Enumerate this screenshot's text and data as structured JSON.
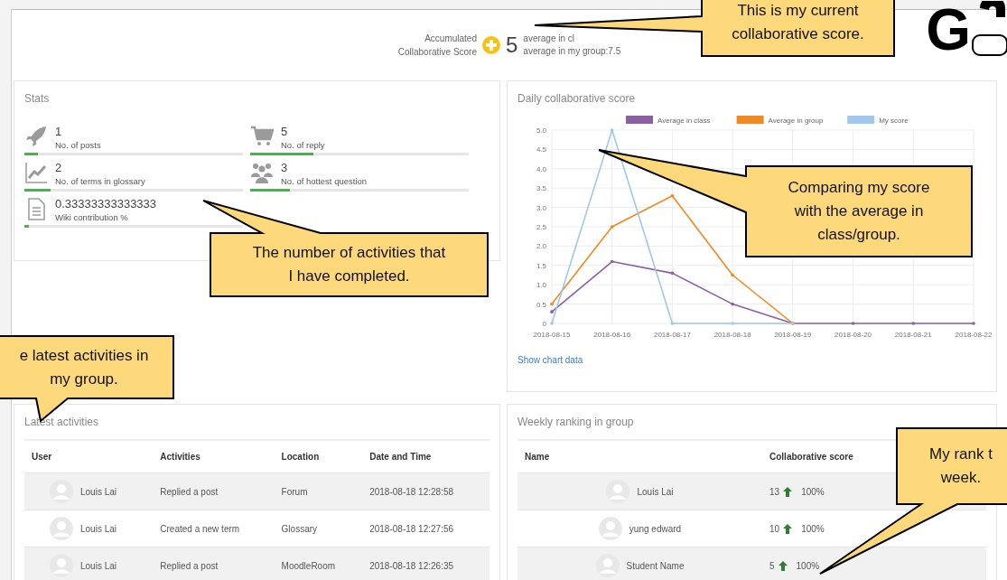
{
  "header": {
    "score_label": "Accumulated Collaborative Score",
    "score": "5",
    "average_class": "average in cl",
    "average_group": "average in my group:7.5"
  },
  "logo": {
    "text": "G"
  },
  "stats": {
    "title": "Stats",
    "items": [
      {
        "value": "1",
        "label": "No. of posts",
        "level": 0.06
      },
      {
        "value": "5",
        "label": "No. of reply",
        "level": 0.29
      },
      {
        "value": "2",
        "label": "No. of terms in glossary",
        "level": 0.12
      },
      {
        "value": "3",
        "label": "No. of hottest question",
        "level": 0.18
      },
      {
        "value": "0.33333333333333",
        "label": "Wiki contribution %",
        "level": 0.02
      }
    ]
  },
  "daily": {
    "title": "Daily collaborative score",
    "link": "Show chart data",
    "chart_data": {
      "type": "line",
      "grid": true,
      "legend": true,
      "categories": [
        "2018-08-15",
        "2018-08-16",
        "2018-08-17",
        "2018-08-18",
        "2018-08-19",
        "2018-08-20",
        "2018-08-21",
        "2018-08-22"
      ],
      "ylim": [
        0,
        5
      ],
      "yticks": [
        {
          "value": 0,
          "label": "0"
        },
        {
          "value": 0.5,
          "label": "0.5"
        },
        {
          "value": 1,
          "label": "1.0"
        },
        {
          "value": 1.5,
          "label": "1.5"
        },
        {
          "value": 2,
          "label": "2.0"
        },
        {
          "value": 2.5,
          "label": "2.5"
        },
        {
          "value": 3,
          "label": "3.0"
        },
        {
          "value": 3.5,
          "label": "3.5"
        },
        {
          "value": 4,
          "label": "4.0"
        },
        {
          "value": 4.5,
          "label": "4.5"
        },
        {
          "value": 5,
          "label": "5.0"
        }
      ],
      "series": [
        {
          "name": "Average in class",
          "color": "#8e5ea2",
          "values": [
            0.3,
            1.6,
            1.3,
            0.5,
            0,
            0,
            0,
            0
          ]
        },
        {
          "name": "Average in group",
          "color": "#f0891e",
          "values": [
            0.5,
            2.5,
            3.3,
            1.25,
            0,
            null,
            null,
            null
          ]
        },
        {
          "name": "My score",
          "color": "#9fc8ec",
          "values": [
            0,
            5,
            0,
            0,
            0,
            null,
            null,
            null
          ]
        }
      ]
    }
  },
  "activities": {
    "title": "Latest activities",
    "columns": [
      "User",
      "Activities",
      "Location",
      "Date and Time"
    ],
    "rows": [
      {
        "user": "Louis Lai",
        "activity": "Replied a post",
        "location": "Forum",
        "datetime": "2018-08-18 12:28:58"
      },
      {
        "user": "Louis Lai",
        "activity": "Created a new term",
        "location": "Glossary",
        "datetime": "2018-08-18 12:27:56"
      },
      {
        "user": "Louis Lai",
        "activity": "Replied a post",
        "location": "MoodleRoom",
        "datetime": "2018-08-18 12:26:35"
      }
    ]
  },
  "ranking": {
    "title": "Weekly ranking in group",
    "columns": [
      "Name",
      "Collaborative score"
    ],
    "rows": [
      {
        "name": "Louis Lai",
        "score": "13",
        "percent": "100%"
      },
      {
        "name": "yung edward",
        "score": "10",
        "percent": "100%"
      },
      {
        "name": "Student Name",
        "score": "5",
        "percent": "100%"
      }
    ]
  },
  "callouts": [
    {
      "lines": [
        "This is my current",
        "collaborative score."
      ]
    },
    {
      "lines": [
        "The number of activities that",
        "I have completed."
      ]
    },
    {
      "lines": [
        "e latest activities in",
        "my group."
      ]
    },
    {
      "lines": [
        "Comparing my score",
        "with the average in",
        "class/group."
      ]
    },
    {
      "lines": [
        "My rank t",
        "week."
      ]
    }
  ]
}
